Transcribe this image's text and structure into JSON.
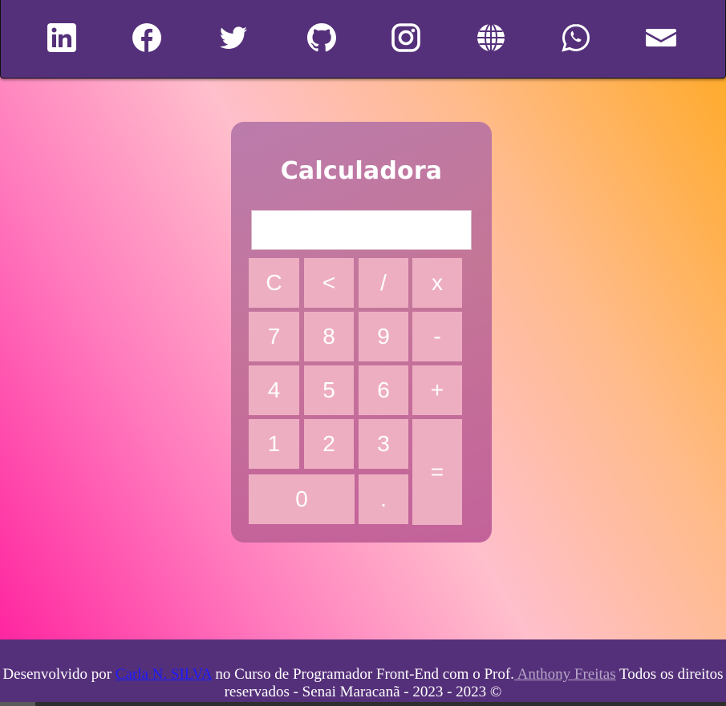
{
  "social": [
    {
      "name": "linkedin-icon",
      "label": "LinkedIn"
    },
    {
      "name": "facebook-icon",
      "label": "Facebook"
    },
    {
      "name": "twitter-icon",
      "label": "Twitter"
    },
    {
      "name": "github-icon",
      "label": "GitHub"
    },
    {
      "name": "instagram-icon",
      "label": "Instagram"
    },
    {
      "name": "globe-icon",
      "label": "Website"
    },
    {
      "name": "whatsapp-icon",
      "label": "WhatsApp"
    },
    {
      "name": "envelope-icon",
      "label": "Email"
    }
  ],
  "calculator": {
    "title": "Calculadora",
    "display_value": "",
    "keys": [
      "C",
      "<",
      "/",
      "x",
      "7",
      "8",
      "9",
      "-",
      "4",
      "5",
      "6",
      "+",
      "1",
      "2",
      "3",
      "=",
      "0",
      "."
    ]
  },
  "footer": {
    "prefix": "Desenvolvido por ",
    "author": "Carla N. SILVA",
    "middle": " no Curso de Programador Front-End com o Prof.",
    "teacher": " Anthony Freitas",
    "suffix": " Todos os direitos reservados - Senai Maracanã - 2023 - 2023 ©"
  },
  "colors": {
    "header_bg": "#55307a",
    "footer_bg": "#55307a",
    "key_bg": "#eeaec2",
    "author_link": "#1a1aff",
    "teacher_link": "#b7a6c8"
  }
}
